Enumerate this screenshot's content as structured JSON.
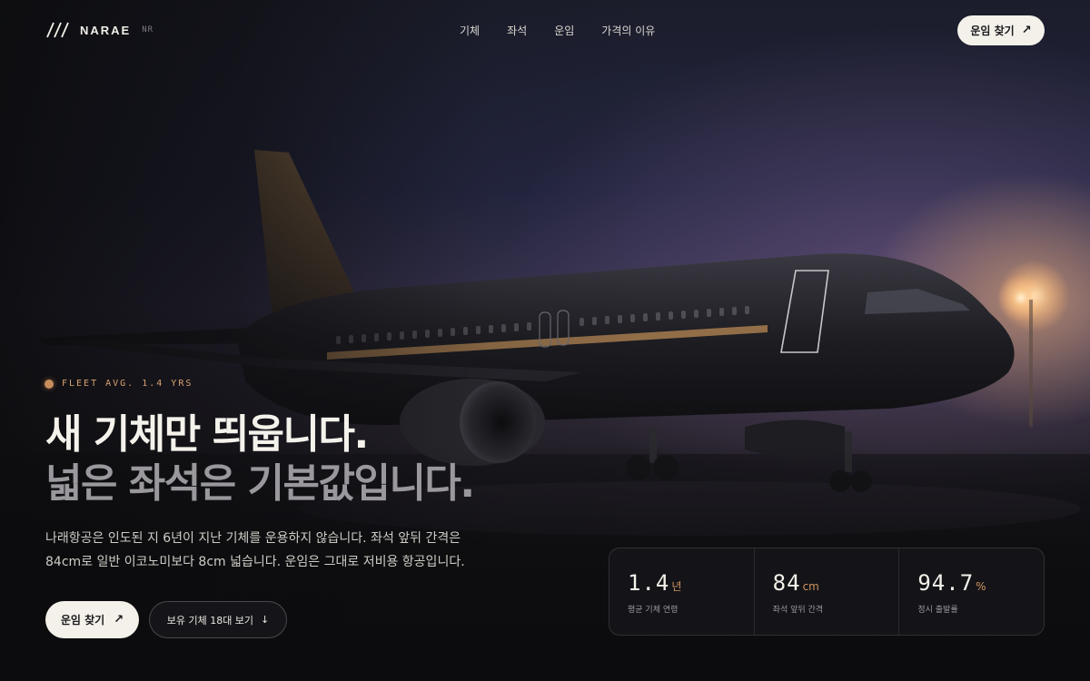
{
  "brand": {
    "name": "NARAE",
    "code": "NR"
  },
  "nav": {
    "items": [
      "기체",
      "좌석",
      "운임",
      "가격의 이유"
    ],
    "cta": "운임 찾기"
  },
  "hero": {
    "badge": "FLEET AVG. 1.4 YRS",
    "headline_1": "새 기체만 띄웁니다.",
    "headline_2": "넓은 좌석은 기본값입니다.",
    "description_1": "나래항공은 인도된 지 6년이 지난 기체를 운용하지 않습니다. 좌석 앞뒤 간격은",
    "description_2": "84cm로 일반 이코노미보다 8cm 넓습니다. 운임은 그대로 저비용 항공입니다.",
    "primary_button": "운임 찾기",
    "secondary_button": "보유 기체 18대 보기"
  },
  "stats": [
    {
      "value": "1.4",
      "unit": "년",
      "label": "평균 기체 연령"
    },
    {
      "value": "84",
      "unit": "cm",
      "label": "좌석 앞뒤 간격"
    },
    {
      "value": "94.7",
      "unit": "%",
      "label": "정시 출발률"
    }
  ],
  "colors": {
    "accent": "#d29563",
    "button_bg": "#f4f1ea",
    "background": "#141418"
  },
  "icons": {
    "logo": "slash-stripes-logo",
    "arrow": "arrow-up-right-icon",
    "down": "arrow-down-icon"
  }
}
